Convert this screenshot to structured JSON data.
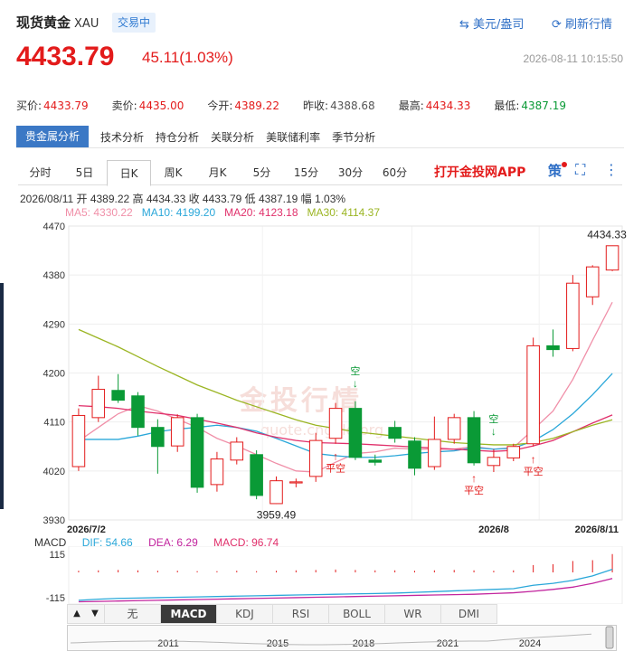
{
  "header": {
    "title": "现货黄金",
    "code": "XAU",
    "status": "交易中",
    "currency_link": "美元/盎司",
    "refresh_link": "刷新行情"
  },
  "quote": {
    "price": "4433.79",
    "change": "45.11(1.03%)",
    "datetime": "2026-08-11 10:15:50"
  },
  "stats": [
    {
      "label": "买价:",
      "value": "4433.79",
      "tone": "red"
    },
    {
      "label": "卖价:",
      "value": "4435.00",
      "tone": "red"
    },
    {
      "label": "今开:",
      "value": "4389.22",
      "tone": "red"
    },
    {
      "label": "昨收:",
      "value": "4388.68",
      "tone": "gray"
    },
    {
      "label": "最高:",
      "value": "4434.33",
      "tone": "red"
    },
    {
      "label": "最低:",
      "value": "4387.19",
      "tone": "green"
    }
  ],
  "tabs": [
    "贵金属分析",
    "技术分析",
    "持仓分析",
    "关联分析",
    "美联储利率",
    "季节分析"
  ],
  "periods": [
    "分时",
    "5日",
    "日K",
    "周K",
    "月K",
    "5分",
    "15分",
    "30分",
    "60分"
  ],
  "app_link": "打开金投网APP",
  "controls": {
    "strategy": "策",
    "fullscreen": "⛶",
    "more": "⋮"
  },
  "ohlc_line": "2026/08/11  开 4389.22  高 4434.33  收 4433.79  低 4387.19  幅 1.03%",
  "ma": [
    {
      "label": "MA5:",
      "value": "4330.22",
      "color": "#f08fa8"
    },
    {
      "label": "MA10:",
      "value": "4199.20",
      "color": "#2aa7d9"
    },
    {
      "label": "MA20:",
      "value": "4123.18",
      "color": "#e0306b"
    },
    {
      "label": "MA30:",
      "value": "4114.37",
      "color": "#9bb523"
    }
  ],
  "watermark": {
    "cn": "金投行情",
    "en": "quote.cngold.org"
  },
  "macd": {
    "label": "MACD",
    "dif_label": "DIF: 54.66",
    "dea_label": "DEA: 6.29",
    "macd_label": "MACD: 96.74",
    "ticks": [
      "115",
      "-115"
    ],
    "colors": {
      "dif": "#2aa7d9",
      "dea": "#c2259e",
      "macd": "#e0306b"
    }
  },
  "indicator_tabs": [
    "无",
    "MACD",
    "KDJ",
    "RSI",
    "BOLL",
    "WR",
    "DMI"
  ],
  "indicator_active": "MACD",
  "navigator": {
    "years": [
      "2011",
      "2015",
      "2018",
      "2021",
      "2024"
    ]
  },
  "chart_data": {
    "type": "candlestick",
    "y_ticks": [
      "4470",
      "4380",
      "4290",
      "4200",
      "4110",
      "4020",
      "3930"
    ],
    "ylim": [
      3930,
      4470
    ],
    "x_labels": [
      "2026/7/2",
      "2026/8",
      "2026/8/11"
    ],
    "up_color": "#e31b1b",
    "down_color": "#0a9a36",
    "candles": [
      {
        "o": 4028,
        "c": 4122,
        "h": 4135,
        "l": 4020
      },
      {
        "o": 4118,
        "c": 4170,
        "h": 4195,
        "l": 4110
      },
      {
        "o": 4168,
        "c": 4150,
        "h": 4198,
        "l": 4145
      },
      {
        "o": 4158,
        "c": 4100,
        "h": 4165,
        "l": 4085
      },
      {
        "o": 4100,
        "c": 4065,
        "h": 4115,
        "l": 4015
      },
      {
        "o": 4066,
        "c": 4118,
        "h": 4124,
        "l": 4055
      },
      {
        "o": 4118,
        "c": 3990,
        "h": 4125,
        "l": 3980
      },
      {
        "o": 3995,
        "c": 4042,
        "h": 4055,
        "l": 3982
      },
      {
        "o": 4040,
        "c": 4073,
        "h": 4082,
        "l": 4032
      },
      {
        "o": 4050,
        "c": 3975,
        "h": 4058,
        "l": 3968
      },
      {
        "o": 3960,
        "c": 4002,
        "h": 4010,
        "l": 3959.49
      },
      {
        "o": 3998,
        "c": 4000,
        "h": 4006,
        "l": 3990
      },
      {
        "o": 4010,
        "c": 4076,
        "h": 4090,
        "l": 4000
      },
      {
        "o": 4080,
        "c": 4135,
        "h": 4145,
        "l": 4070
      },
      {
        "o": 4135,
        "c": 4045,
        "h": 4148,
        "l": 4040
      },
      {
        "o": 4040,
        "c": 4036,
        "h": 4050,
        "l": 4030
      },
      {
        "o": 4100,
        "c": 4080,
        "h": 4112,
        "l": 4072
      },
      {
        "o": 4075,
        "c": 4025,
        "h": 4082,
        "l": 4012
      },
      {
        "o": 4028,
        "c": 4078,
        "h": 4120,
        "l": 4022
      },
      {
        "o": 4078,
        "c": 4118,
        "h": 4125,
        "l": 4070
      },
      {
        "o": 4118,
        "c": 4035,
        "h": 4130,
        "l": 4030
      },
      {
        "o": 4030,
        "c": 4045,
        "h": 4060,
        "l": 4018
      },
      {
        "o": 4044,
        "c": 4065,
        "h": 4070,
        "l": 4038
      },
      {
        "o": 4070,
        "c": 4250,
        "h": 4265,
        "l": 4065
      },
      {
        "o": 4250,
        "c": 4243,
        "h": 4280,
        "l": 4230
      },
      {
        "o": 4245,
        "c": 4365,
        "h": 4380,
        "l": 4240
      },
      {
        "o": 4340,
        "c": 4395,
        "h": 4398,
        "l": 4325
      },
      {
        "o": 4389.22,
        "c": 4433.79,
        "h": 4434.33,
        "l": 4387.19
      }
    ],
    "ma_lines": {
      "ma5": [
        4075,
        4100,
        4125,
        4140,
        4130,
        4115,
        4100,
        4080,
        4066,
        4050,
        4034,
        4020,
        4018,
        4036,
        4052,
        4055,
        4062,
        4060,
        4060,
        4060,
        4065,
        4060,
        4063,
        4096,
        4130,
        4188,
        4260,
        4330
      ],
      "ma10": [
        4078,
        4078,
        4078,
        4084,
        4092,
        4097,
        4100,
        4104,
        4100,
        4093,
        4080,
        4066,
        4052,
        4048,
        4045,
        4045,
        4048,
        4052,
        4055,
        4057,
        4063,
        4060,
        4062,
        4075,
        4096,
        4125,
        4160,
        4199
      ],
      "ma20": [
        4140,
        4138,
        4135,
        4130,
        4126,
        4122,
        4115,
        4108,
        4100,
        4090,
        4082,
        4076,
        4072,
        4071,
        4070,
        4068,
        4066,
        4064,
        4062,
        4060,
        4058,
        4056,
        4058,
        4066,
        4076,
        4092,
        4108,
        4123
      ],
      "ma30": [
        4280,
        4264,
        4248,
        4230,
        4212,
        4195,
        4178,
        4164,
        4150,
        4138,
        4126,
        4114,
        4104,
        4098,
        4092,
        4088,
        4084,
        4080,
        4076,
        4072,
        4070,
        4068,
        4068,
        4072,
        4080,
        4092,
        4104,
        4114
      ]
    },
    "annotations": [
      {
        "index": 10,
        "text": "3959.49",
        "kind": "low"
      },
      {
        "index": 27,
        "text": "4434.33",
        "kind": "high"
      },
      {
        "index": 14,
        "text": "空",
        "kind": "short"
      },
      {
        "index": 13,
        "text": "平空",
        "kind": "cover"
      },
      {
        "index": 21,
        "text": "空",
        "kind": "short"
      },
      {
        "index": 20,
        "text": "平空",
        "kind": "cover"
      },
      {
        "index": 23,
        "text": "平空",
        "kind": "cover"
      }
    ],
    "macd_hist": [
      4,
      5,
      6,
      5,
      4,
      4,
      3,
      3,
      4,
      3,
      4,
      5,
      6,
      7,
      6,
      5,
      5,
      4,
      5,
      6,
      5,
      4,
      5,
      18,
      20,
      28,
      30,
      45
    ],
    "dif": [
      -110,
      -104,
      -100,
      -98,
      -96,
      -94,
      -92,
      -90,
      -88,
      -86,
      -84,
      -82,
      -80,
      -78,
      -76,
      -74,
      -72,
      -68,
      -64,
      -60,
      -56,
      -52,
      -48,
      -30,
      -20,
      -4,
      20,
      54.66
    ],
    "dea": [
      -118,
      -116,
      -114,
      -112,
      -110,
      -108,
      -106,
      -104,
      -102,
      -100,
      -98,
      -96,
      -94,
      -92,
      -90,
      -88,
      -86,
      -84,
      -82,
      -80,
      -78,
      -74,
      -70,
      -62,
      -52,
      -40,
      -20,
      6.29
    ]
  }
}
